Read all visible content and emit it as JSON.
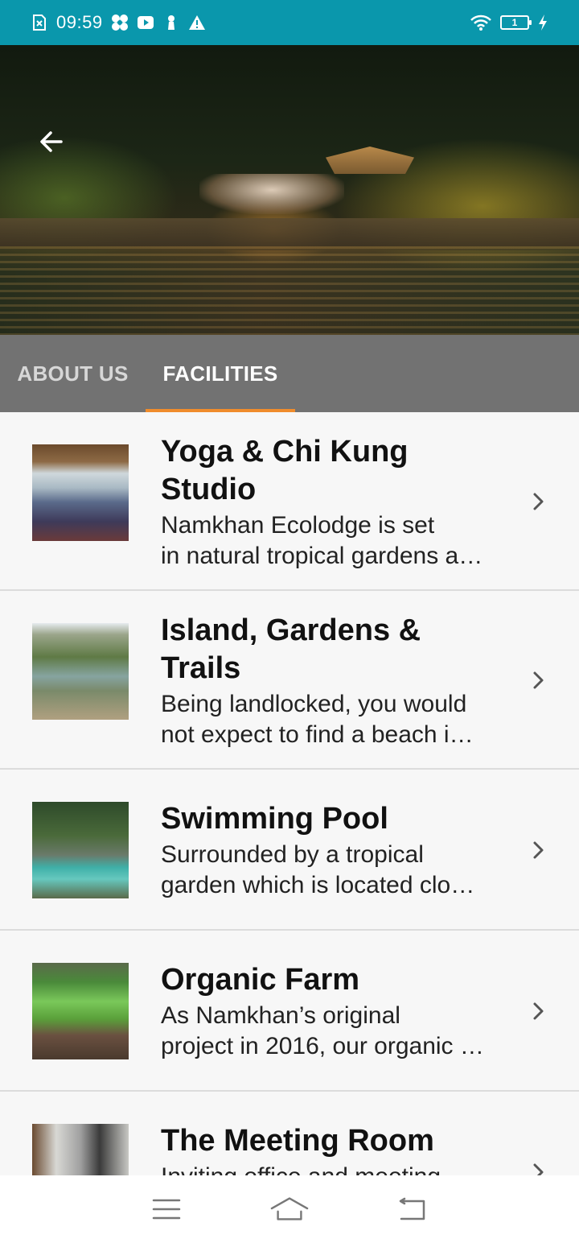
{
  "status_bar": {
    "time": "09:59",
    "left_icons": [
      "sim-x-icon",
      "pinwheel-icon",
      "youtube-icon",
      "keyhole-icon",
      "warning-icon"
    ],
    "right_icons": [
      "wifi-icon",
      "battery-icon",
      "charging-icon"
    ],
    "battery_level": "1"
  },
  "hero": {
    "carousel_total": 5,
    "carousel_active_index": 0
  },
  "tabs": [
    {
      "label": "ABOUT US",
      "selected": false
    },
    {
      "label": "FACILITIES",
      "selected": true
    }
  ],
  "colors": {
    "status_bar": "#0a97ac",
    "tab_bar": "#727272",
    "tab_indicator": "#f08c2c"
  },
  "facilities": [
    {
      "title_lines": [
        "Yoga & Chi Kung",
        "Studio"
      ],
      "desc_lines": [
        "Namkhan Ecolodge is set",
        "in natural tropical gardens a…"
      ]
    },
    {
      "title_lines": [
        "Island, Gardens &",
        "Trails"
      ],
      "desc_lines": [
        "Being landlocked, you would",
        "not expect to find a beach i…"
      ]
    },
    {
      "title_lines": [
        "Swimming Pool"
      ],
      "desc_lines": [
        "Surrounded by a tropical",
        "garden which is located clo…"
      ]
    },
    {
      "title_lines": [
        "Organic Farm"
      ],
      "desc_lines": [
        "As Namkhan’s original",
        "project in 2016, our organic …"
      ]
    },
    {
      "title_lines": [
        "The Meeting Room"
      ],
      "desc_lines": [
        "Inviting office and meeting",
        ""
      ]
    }
  ],
  "nav_bar": {
    "buttons": [
      "menu-icon",
      "home-icon",
      "back-icon"
    ]
  }
}
